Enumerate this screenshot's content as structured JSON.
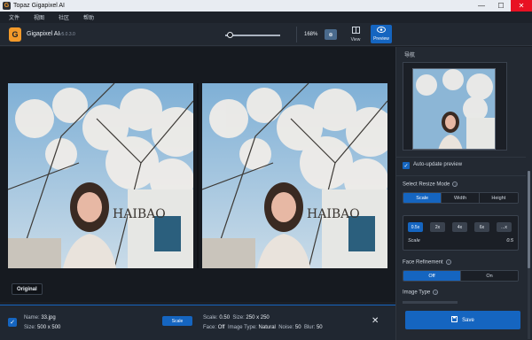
{
  "window": {
    "title": "Topaz Gigapixel AI",
    "minimize": "—",
    "maximize": "☐",
    "close": "✕"
  },
  "menu": [
    "文件",
    "视图",
    "社区",
    "帮助"
  ],
  "toolbar": {
    "app_name": "Gigapixel AI",
    "version": "v5.0.3.0",
    "zoom": "168%",
    "zoom_btn": "⊕",
    "view_label": "View",
    "preview_label": "Preview"
  },
  "image": {
    "watermark": "HAIBAO"
  },
  "main": {
    "original_label": "Original"
  },
  "file": {
    "name_label": "Name:",
    "name": "33.jpg",
    "size_label": "Size:",
    "size": "500 x 500",
    "scale_button": "Scale",
    "scale_label": "Scale:",
    "scale": "0.50",
    "out_size_label": "Size:",
    "out_size": "250 x 250",
    "face_label": "Face:",
    "face": "Off",
    "type_label": "Image Type:",
    "type": "Natural",
    "noise_label": "Noise:",
    "noise": "50",
    "blur_label": "Blur:",
    "blur": "50"
  },
  "side": {
    "nav_title": "导航",
    "auto_update": "Auto-update preview",
    "resize_title": "Select Resize Mode",
    "resize_modes": [
      "Scale",
      "Width",
      "Height"
    ],
    "scale_chips": [
      "0.5x",
      "2x",
      "4x",
      "6x",
      "...x"
    ],
    "scale_label": "Scale",
    "scale_value": "0.5",
    "face_title": "Face Refinement",
    "face_modes": [
      "Off",
      "On"
    ],
    "imgtype_title": "Image Type",
    "save": "Save"
  },
  "colors": {
    "accent": "#1565c0",
    "logo": "#f39a2a"
  }
}
